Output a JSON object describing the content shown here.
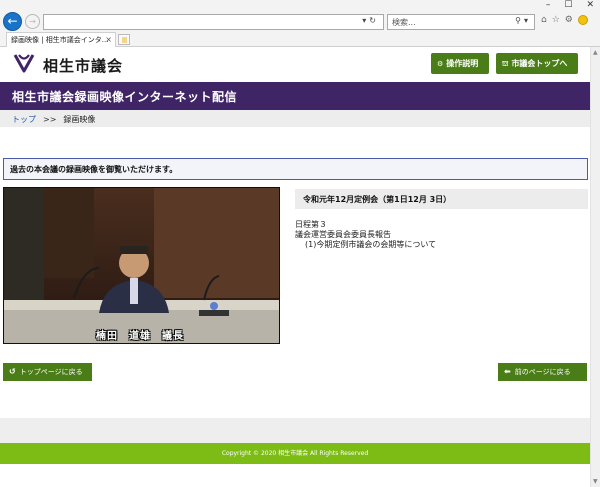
{
  "browser": {
    "tab_title": "録画映像 | 相生市議会インタ...",
    "tab_close": "×",
    "search_placeholder": "検索...",
    "address_value": ""
  },
  "header": {
    "site_name": "相生市議会",
    "guide_button": "操作説明",
    "home_button": "市議会トップへ"
  },
  "title_bar": {
    "title": "相生市議会録画映像インターネット配信"
  },
  "breadcrumb": {
    "home": "トップ",
    "separator": ">>",
    "current": "録画映像"
  },
  "notice": "過去の本会議の録画映像を御覧いただけます。",
  "video": {
    "caption_name": "楠田　道雄　議長"
  },
  "meeting": {
    "heading": "令和元年12月定例会（第1日12月 3日）",
    "agenda": [
      "日程第３",
      "議会運営委員会委員長報告",
      "(1)今期定例市議会の会期等について"
    ]
  },
  "nav": {
    "top_page": "トップページに戻る",
    "prev_page": "前のページに戻る"
  },
  "footer": {
    "copyright": "Copyright © 2020 相生市議会 All Rights Reserved"
  },
  "colors": {
    "brand_purple": "#3f2466",
    "button_green": "#4a7d18",
    "footer_green": "#7dbc15",
    "link_blue": "#1d57a8"
  }
}
